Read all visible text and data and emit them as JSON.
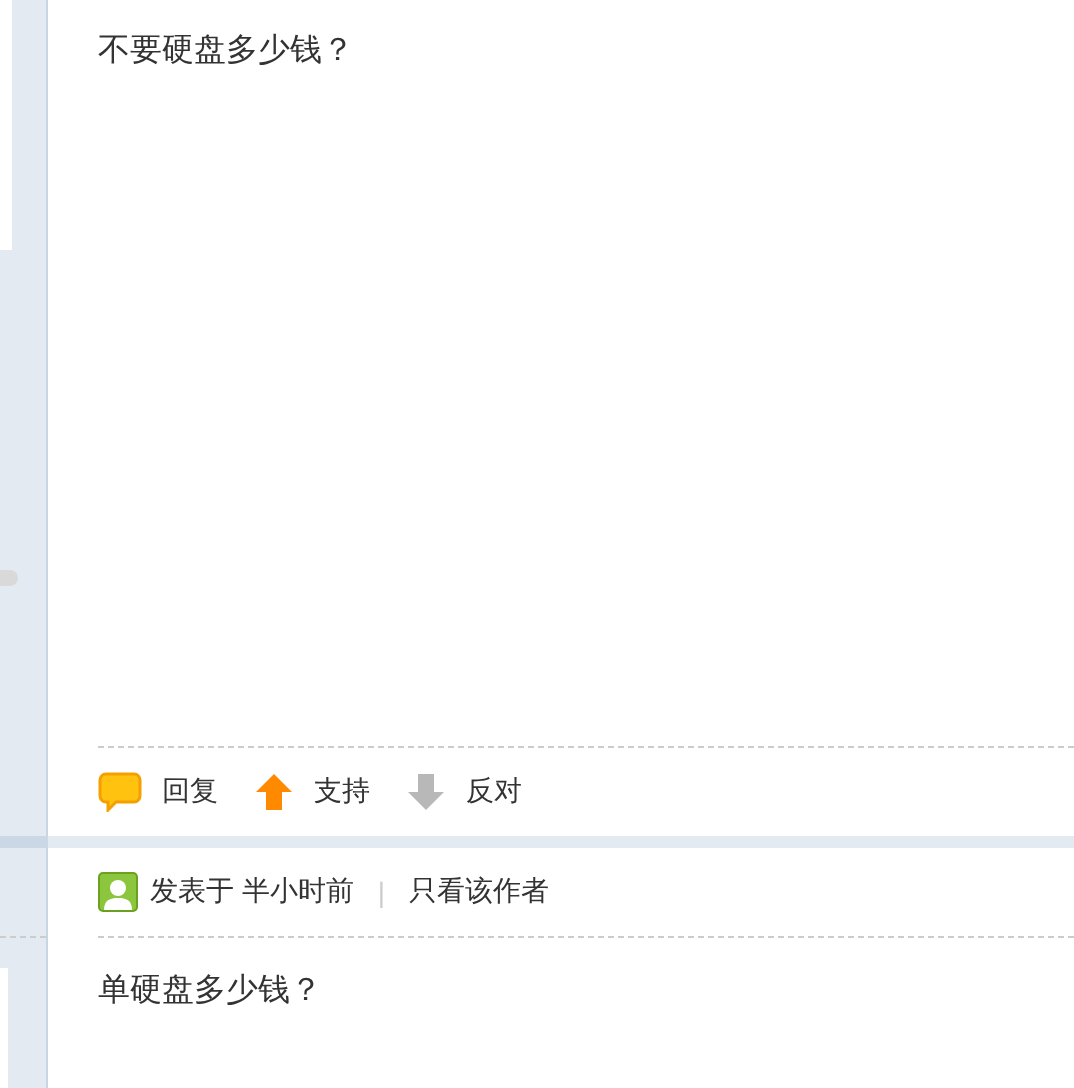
{
  "posts": [
    {
      "content": "不要硬盘多少钱？",
      "actions": [
        {
          "kind": "reply",
          "label": "回复"
        },
        {
          "kind": "support",
          "label": "支持"
        },
        {
          "kind": "oppose",
          "label": "反对"
        }
      ]
    },
    {
      "meta": {
        "posted": "发表于 半小时前",
        "separator": "|",
        "author_only": "只看该作者"
      },
      "content": "单硬盘多少钱？"
    }
  ]
}
